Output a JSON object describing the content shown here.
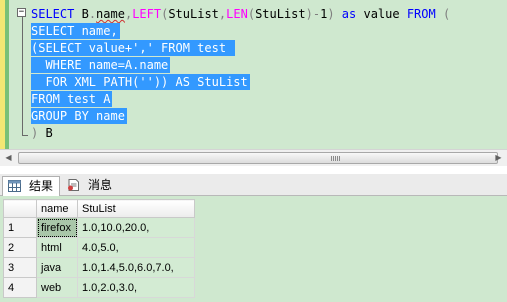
{
  "editor": {
    "fold_toggle": "−",
    "lines": [
      {
        "tokens": [
          {
            "t": "SELECT ",
            "c": "kw"
          },
          {
            "t": "B",
            "c": "txt"
          },
          {
            "t": ".",
            "c": "op"
          },
          {
            "t": "name",
            "c": "txt sq"
          },
          {
            "t": ",",
            "c": "op"
          },
          {
            "t": "LEFT",
            "c": "fn"
          },
          {
            "t": "(",
            "c": "op"
          },
          {
            "t": "StuList",
            "c": "txt"
          },
          {
            "t": ",",
            "c": "op"
          },
          {
            "t": "LEN",
            "c": "fn"
          },
          {
            "t": "(",
            "c": "op"
          },
          {
            "t": "StuList",
            "c": "txt"
          },
          {
            "t": ")-",
            "c": "op"
          },
          {
            "t": "1",
            "c": "txt"
          },
          {
            "t": ") ",
            "c": "op"
          },
          {
            "t": "as ",
            "c": "kw"
          },
          {
            "t": "value ",
            "c": "txt"
          },
          {
            "t": "FROM ",
            "c": "kw"
          },
          {
            "t": "(",
            "c": "op"
          }
        ]
      },
      {
        "text": "SELECT name,"
      },
      {
        "text": "(SELECT value+',' FROM test "
      },
      {
        "text": "  WHERE name=A.name"
      },
      {
        "text": "  FOR XML PATH('')) AS StuList"
      },
      {
        "text": "FROM test A"
      },
      {
        "text": "GROUP BY name"
      },
      {
        "tokens": [
          {
            "t": ") ",
            "c": "op"
          },
          {
            "t": "B",
            "c": "txt"
          }
        ]
      }
    ]
  },
  "tabs": [
    {
      "label": "结果",
      "icon": "grid-results-icon",
      "active": true
    },
    {
      "label": "消息",
      "icon": "messages-icon",
      "active": false
    }
  ],
  "results": {
    "columns": [
      "name",
      "StuList"
    ],
    "rows": [
      {
        "num": "1",
        "name": "firefox",
        "stulist": "1.0,10.0,20.0,"
      },
      {
        "num": "2",
        "name": "html",
        "stulist": "4.0,5.0,"
      },
      {
        "num": "3",
        "name": "java",
        "stulist": "1.0,1.4,5.0,6.0,7.0,"
      },
      {
        "num": "4",
        "name": "web",
        "stulist": "1.0,2.0,3.0,"
      }
    ]
  },
  "colors": {
    "editor_bg": "#cfe8cf",
    "selection": "#3399ff",
    "keyword": "#0000ff",
    "function": "#ff00ff",
    "operator": "#7f7f7f"
  }
}
